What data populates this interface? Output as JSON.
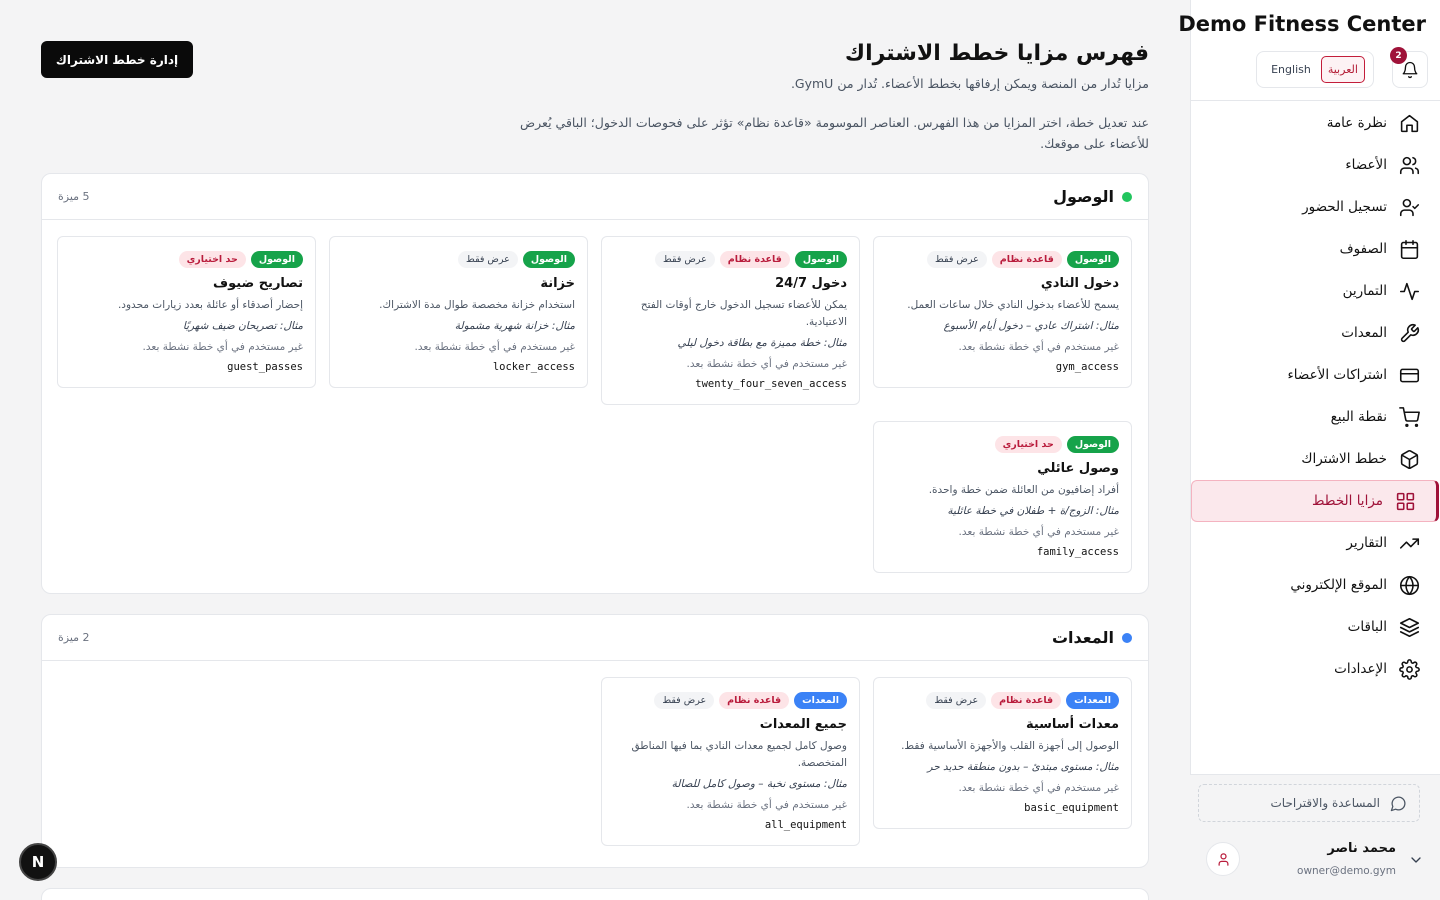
{
  "sidebar": {
    "brand": "Demo Fitness Center",
    "lang_ar": "العربية",
    "lang_en": "English",
    "notification_count": "2",
    "items": [
      {
        "label": "نظرة عامة",
        "icon": "home-icon"
      },
      {
        "label": "الأعضاء",
        "icon": "users-icon"
      },
      {
        "label": "تسجيل الحضور",
        "icon": "user-check-icon"
      },
      {
        "label": "الصفوف",
        "icon": "calendar-icon"
      },
      {
        "label": "التمارين",
        "icon": "activity-icon"
      },
      {
        "label": "المعدات",
        "icon": "wrench-icon"
      },
      {
        "label": "اشتراكات الأعضاء",
        "icon": "credit-card-icon"
      },
      {
        "label": "نقطة البيع",
        "icon": "cart-icon"
      },
      {
        "label": "خطط الاشتراك",
        "icon": "package-icon"
      },
      {
        "label": "مزايا الخطط",
        "icon": "grid-icon"
      },
      {
        "label": "التقارير",
        "icon": "trending-up-icon"
      },
      {
        "label": "الموقع الإلكتروني",
        "icon": "globe-icon"
      },
      {
        "label": "الباقات",
        "icon": "layers-icon"
      },
      {
        "label": "الإعدادات",
        "icon": "gear-icon"
      }
    ],
    "active_index": 9,
    "help_label": "المساعدة والاقتراحات",
    "user_name": "محمد ناصر",
    "user_email": "owner@demo.gym"
  },
  "header": {
    "title": "فهرس مزايا خطط الاشتراك",
    "subtitle": "مزايا تُدار من المنصة ويمكن إرفاقها بخطط الأعضاء. تُدار من GymU.",
    "description": "عند تعديل خطة، اختر المزايا من هذا الفهرس. العناصر الموسومة «قاعدة نظام» تؤثر على فحوصات الدخول؛ الباقي يُعرض للأعضاء على موقعك.",
    "manage_button": "إدارة خطط الاشتراك"
  },
  "sections": [
    {
      "title": "الوصول",
      "color": "#22c55e",
      "count": "5 ميزة",
      "cards": [
        {
          "tags": [
            {
              "t": "الوصول",
              "c": "green"
            },
            {
              "t": "قاعدة نظام",
              "c": "red"
            },
            {
              "t": "عرض فقط",
              "c": "gray"
            }
          ],
          "name": "دخول النادي",
          "desc": "يسمح للأعضاء بدخول النادي خلال ساعات العمل.",
          "example": "مثال: اشتراك عادي – دخول أيام الأسبوع",
          "usage": "غير مستخدم في أي خطة نشطة بعد.",
          "key": "gym_access"
        },
        {
          "tags": [
            {
              "t": "الوصول",
              "c": "green"
            },
            {
              "t": "قاعدة نظام",
              "c": "red"
            },
            {
              "t": "عرض فقط",
              "c": "gray"
            }
          ],
          "name": "دخول 24/7",
          "desc": "يمكن للأعضاء تسجيل الدخول خارج أوقات الفتح الاعتيادية.",
          "example": "مثال: خطة مميزة مع بطاقة دخول ليلي",
          "usage": "غير مستخدم في أي خطة نشطة بعد.",
          "key": "twenty_four_seven_access"
        },
        {
          "tags": [
            {
              "t": "الوصول",
              "c": "green"
            },
            {
              "t": "عرض فقط",
              "c": "gray"
            }
          ],
          "name": "خزانة",
          "desc": "استخدام خزانة مخصصة طوال مدة الاشتراك.",
          "example": "مثال: خزانة شهرية مشمولة",
          "usage": "غير مستخدم في أي خطة نشطة بعد.",
          "key": "locker_access"
        },
        {
          "tags": [
            {
              "t": "الوصول",
              "c": "green"
            },
            {
              "t": "حد اختياري",
              "c": "red"
            }
          ],
          "name": "تصاريح ضيوف",
          "desc": "إحضار أصدقاء أو عائلة بعدد زيارات محدود.",
          "example": "مثال: تصريحان ضيف شهريًا",
          "usage": "غير مستخدم في أي خطة نشطة بعد.",
          "key": "guest_passes"
        },
        {
          "tags": [
            {
              "t": "الوصول",
              "c": "green"
            },
            {
              "t": "حد اختياري",
              "c": "red"
            }
          ],
          "name": "وصول عائلي",
          "desc": "أفراد إضافيون من العائلة ضمن خطة واحدة.",
          "example": "مثال: الزوج/ة + طفلان في خطة عائلية",
          "usage": "غير مستخدم في أي خطة نشطة بعد.",
          "key": "family_access"
        }
      ]
    },
    {
      "title": "المعدات",
      "color": "#3b82f6",
      "count": "2 ميزة",
      "cards": [
        {
          "tags": [
            {
              "t": "المعدات",
              "c": "blue"
            },
            {
              "t": "قاعدة نظام",
              "c": "red"
            },
            {
              "t": "عرض فقط",
              "c": "gray"
            }
          ],
          "name": "معدات أساسية",
          "desc": "الوصول إلى أجهزة القلب والأجهزة الأساسية فقط.",
          "example": "مثال: مستوى مبتدئ – بدون منطقة حديد حر",
          "usage": "غير مستخدم في أي خطة نشطة بعد.",
          "key": "basic_equipment"
        },
        {
          "tags": [
            {
              "t": "المعدات",
              "c": "blue"
            },
            {
              "t": "قاعدة نظام",
              "c": "red"
            },
            {
              "t": "عرض فقط",
              "c": "gray"
            }
          ],
          "name": "جميع المعدات",
          "desc": "وصول كامل لجميع معدات النادي بما فيها المناطق المتخصصة.",
          "example": "مثال: مستوى نخبة – وصول كامل للصالة",
          "usage": "غير مستخدم في أي خطة نشطة بعد.",
          "key": "all_equipment"
        }
      ]
    }
  ],
  "devtools_label": "N"
}
